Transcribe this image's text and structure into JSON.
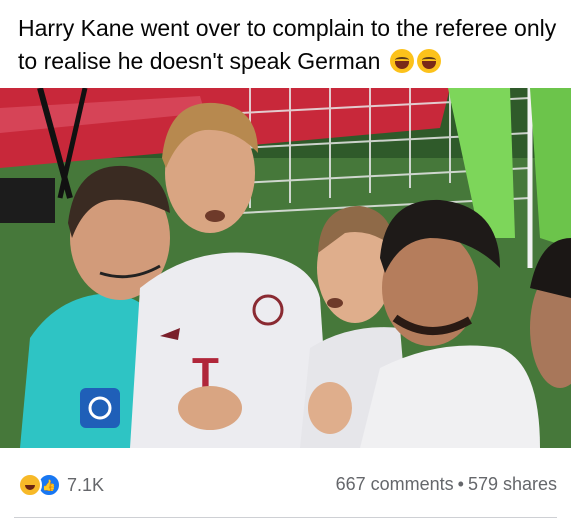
{
  "post": {
    "caption": "Harry Kane went over to complain to the referee only to realise he doesn't speak German",
    "caption_emojis": [
      "face-with-tears-of-joy",
      "face-with-tears-of-joy"
    ]
  },
  "media": {
    "description_icon": "photo",
    "shirt_logo": "T"
  },
  "footer": {
    "reaction_icons": [
      "haha-reaction-icon",
      "like-reaction-icon"
    ],
    "reaction_count": "7.1K",
    "comments": "667 comments",
    "separator": "•",
    "shares": "579 shares"
  },
  "colors": {
    "like_blue": "#1877f2",
    "haha_yellow": "#f7b928",
    "meta_gray": "#65676b"
  }
}
